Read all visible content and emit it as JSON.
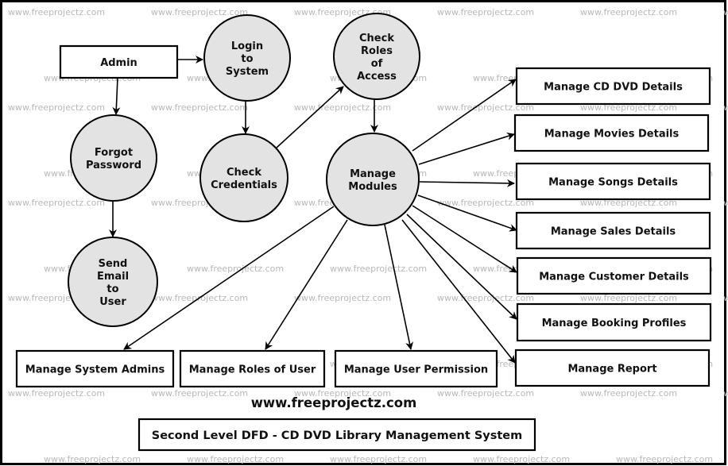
{
  "watermark_text": "www.freeprojectz.com",
  "website_caption": "www.freeprojectz.com",
  "title": "Second Level DFD - CD DVD Library Management System",
  "colors": {
    "process_fill": "#e3e3e3",
    "stroke": "#000000",
    "watermark": "#b8b8b8"
  },
  "entities": [
    {
      "id": "admin",
      "label": "Admin"
    },
    {
      "id": "cd_dvd",
      "label": "Manage CD DVD Details"
    },
    {
      "id": "movies",
      "label": "Manage Movies Details"
    },
    {
      "id": "songs",
      "label": "Manage Songs Details"
    },
    {
      "id": "sales",
      "label": "Manage Sales Details"
    },
    {
      "id": "customer",
      "label": "Manage Customer Details"
    },
    {
      "id": "booking",
      "label": "Manage Booking Profiles"
    },
    {
      "id": "report",
      "label": "Manage Report"
    },
    {
      "id": "sys_admins",
      "label": "Manage System Admins"
    },
    {
      "id": "roles_user",
      "label": "Manage Roles of User"
    },
    {
      "id": "user_perm",
      "label": "Manage User Permission"
    }
  ],
  "processes": [
    {
      "id": "login",
      "lines": [
        "Login",
        "to",
        "System"
      ]
    },
    {
      "id": "check_roles",
      "lines": [
        "Check",
        "Roles",
        "of",
        "Access"
      ]
    },
    {
      "id": "forgot",
      "lines": [
        "Forgot",
        "Password"
      ]
    },
    {
      "id": "check_cred",
      "lines": [
        "Check",
        "Credentials"
      ]
    },
    {
      "id": "manage_modules",
      "lines": [
        "Manage",
        "Modules"
      ]
    },
    {
      "id": "send_email",
      "lines": [
        "Send",
        "Email",
        "to",
        "User"
      ]
    }
  ],
  "flows": [
    {
      "from": "admin",
      "to": "login"
    },
    {
      "from": "admin",
      "to": "forgot"
    },
    {
      "from": "login",
      "to": "check_cred"
    },
    {
      "from": "check_cred",
      "to": "check_roles"
    },
    {
      "from": "check_roles",
      "to": "manage_modules"
    },
    {
      "from": "forgot",
      "to": "send_email"
    },
    {
      "from": "manage_modules",
      "to": "cd_dvd"
    },
    {
      "from": "manage_modules",
      "to": "movies"
    },
    {
      "from": "manage_modules",
      "to": "songs"
    },
    {
      "from": "manage_modules",
      "to": "sales"
    },
    {
      "from": "manage_modules",
      "to": "customer"
    },
    {
      "from": "manage_modules",
      "to": "booking"
    },
    {
      "from": "manage_modules",
      "to": "report"
    },
    {
      "from": "manage_modules",
      "to": "sys_admins"
    },
    {
      "from": "manage_modules",
      "to": "roles_user"
    },
    {
      "from": "manage_modules",
      "to": "user_perm"
    }
  ]
}
